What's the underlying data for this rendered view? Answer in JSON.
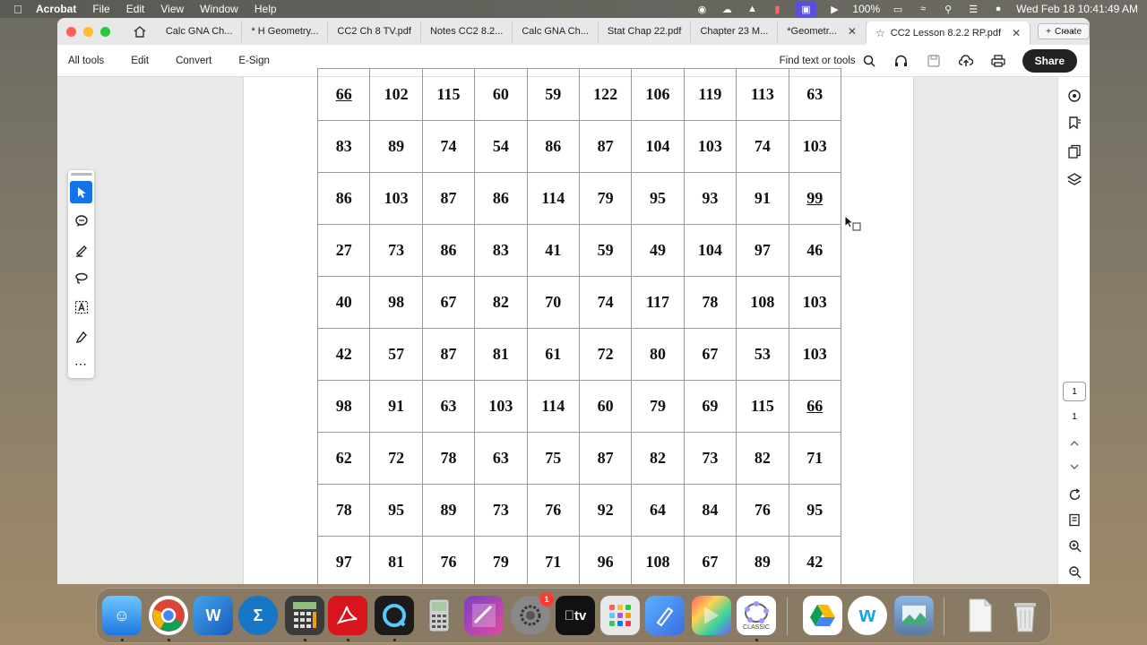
{
  "menubar": {
    "app_name": "Acrobat",
    "items": [
      "File",
      "Edit",
      "View",
      "Window",
      "Help"
    ],
    "battery": "100%",
    "datetime": "Wed Feb 18  10:41:49 AM"
  },
  "tabs": [
    {
      "label": "Calc GNA Ch..."
    },
    {
      "label": "* H Geometry..."
    },
    {
      "label": "CC2 Ch 8 TV.pdf"
    },
    {
      "label": "Notes CC2 8.2..."
    },
    {
      "label": "Calc GNA Ch..."
    },
    {
      "label": "Stat Chap 22.pdf"
    },
    {
      "label": "Chapter 23 M..."
    },
    {
      "label": "*Geometr..."
    },
    {
      "label": "CC2 Lesson 8.2.2 RP.pdf"
    }
  ],
  "create_label": "Create",
  "toolbar": {
    "all_tools": "All tools",
    "edit": "Edit",
    "convert": "Convert",
    "esign": "E-Sign",
    "find": "Find text or tools",
    "share": "Share"
  },
  "grid_rows": [
    [
      "66",
      "102",
      "115",
      "60",
      "59",
      "122",
      "106",
      "119",
      "113",
      "63"
    ],
    [
      "83",
      "89",
      "74",
      "54",
      "86",
      "87",
      "104",
      "103",
      "74",
      "103"
    ],
    [
      "86",
      "103",
      "87",
      "86",
      "114",
      "79",
      "95",
      "93",
      "91",
      "99"
    ],
    [
      "27",
      "73",
      "86",
      "83",
      "41",
      "59",
      "49",
      "104",
      "97",
      "46"
    ],
    [
      "40",
      "98",
      "67",
      "82",
      "70",
      "74",
      "117",
      "78",
      "108",
      "103"
    ],
    [
      "42",
      "57",
      "87",
      "81",
      "61",
      "72",
      "80",
      "67",
      "53",
      "103"
    ],
    [
      "98",
      "91",
      "63",
      "103",
      "114",
      "60",
      "79",
      "69",
      "115",
      "66"
    ],
    [
      "62",
      "72",
      "78",
      "63",
      "75",
      "87",
      "82",
      "73",
      "82",
      "71"
    ],
    [
      "78",
      "95",
      "89",
      "73",
      "76",
      "92",
      "64",
      "84",
      "76",
      "95"
    ],
    [
      "97",
      "81",
      "76",
      "79",
      "71",
      "96",
      "108",
      "67",
      "89",
      "42"
    ]
  ],
  "page_nav": {
    "current": "1",
    "total": "1"
  },
  "dock": {
    "badge_count": "1",
    "classic_label": "CLASSIC"
  },
  "colors": {
    "accent": "#1473e6",
    "share_bg": "#222222"
  }
}
